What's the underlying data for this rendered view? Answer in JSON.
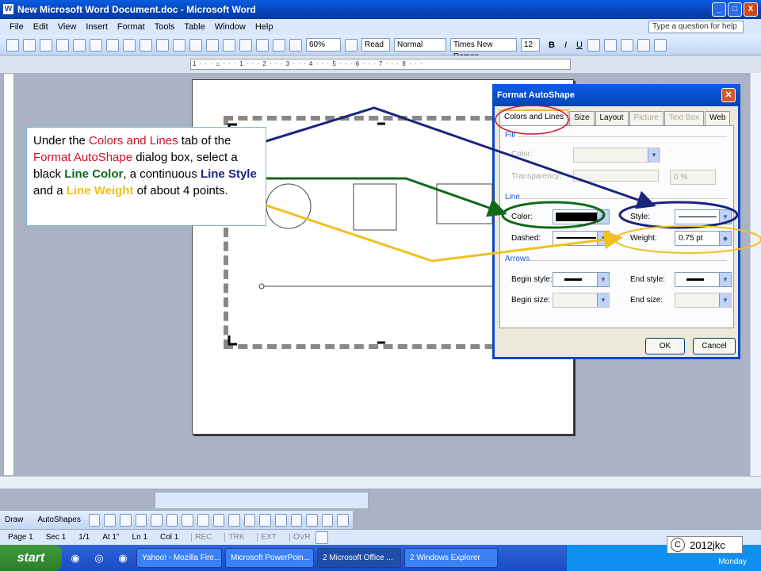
{
  "window": {
    "title": "New Microsoft Word Document.doc - Microsoft Word",
    "controls": [
      "_",
      "□",
      "X"
    ]
  },
  "menu": {
    "items": [
      "File",
      "Edit",
      "View",
      "Insert",
      "Format",
      "Tools",
      "Table",
      "Window",
      "Help"
    ],
    "help_placeholder": "Type a question for help"
  },
  "toolbar": {
    "zoom": "60%",
    "read_label": "Read",
    "style": "Normal",
    "font": "Times New Roman",
    "size": "12",
    "bold": "B",
    "italic": "I",
    "underline": "U"
  },
  "ruler": {
    "marks": "1 · · · ⌂ · · · 1 · · · 2 · · · 3 · · · 4 · · · 5 · · · 6 · · · 7 · · · 8 · · ·"
  },
  "drawing": {
    "draw_label": "Draw",
    "autoshapes_label": "AutoShapes"
  },
  "status": {
    "page": "Page 1",
    "sec": "Sec 1",
    "pages": "1/1",
    "at": "At 1\"",
    "ln": "Ln 1",
    "col": "Col 1",
    "rec": "REC",
    "trk": "TRK",
    "ext": "EXT",
    "ovr": "OVR"
  },
  "taskbar": {
    "start": "start",
    "tasks": [
      "Yahoo! - Mozilla Fire...",
      "Microsoft PowerPoin...",
      "2 Microsoft Office ...",
      "2 Windows Explorer"
    ],
    "clock_day": "Monday"
  },
  "dialog": {
    "title": "Format AutoShape",
    "tabs": [
      "Colors and Lines",
      "Size",
      "Layout",
      "Picture",
      "Text Box",
      "Web"
    ],
    "fill_section": "Fill",
    "fill_color_label": "Color:",
    "transparency_label": "Transparency:",
    "transparency_value": "0 %",
    "line_section": "Line",
    "line_color_label": "Color:",
    "style_label": "Style:",
    "dashed_label": "Dashed:",
    "weight_label": "Weight:",
    "weight_value": "0.75 pt",
    "arrows_section": "Arrows",
    "begin_style_label": "Begin style:",
    "end_style_label": "End style:",
    "begin_size_label": "Begin size:",
    "end_size_label": "End size:",
    "ok": "OK",
    "cancel": "Cancel"
  },
  "callout": {
    "t1": "Under the ",
    "t2": "Colors and Lines",
    "t3": " tab of the ",
    "t4": "Format AutoShape",
    "t5": " dialog box, select a black ",
    "t6": "Line Color",
    "t7": ", a continuous ",
    "t8": "Line Style",
    "t9": " and a ",
    "t10": "Line Weight",
    "t11": " of about 4 points."
  },
  "copyright": {
    "symbol": "C",
    "text": "2012jkc"
  },
  "colors": {
    "navy": "#1a237e",
    "green": "#0f6a18",
    "yellow": "#f0c01e",
    "red": "#d2102b"
  }
}
